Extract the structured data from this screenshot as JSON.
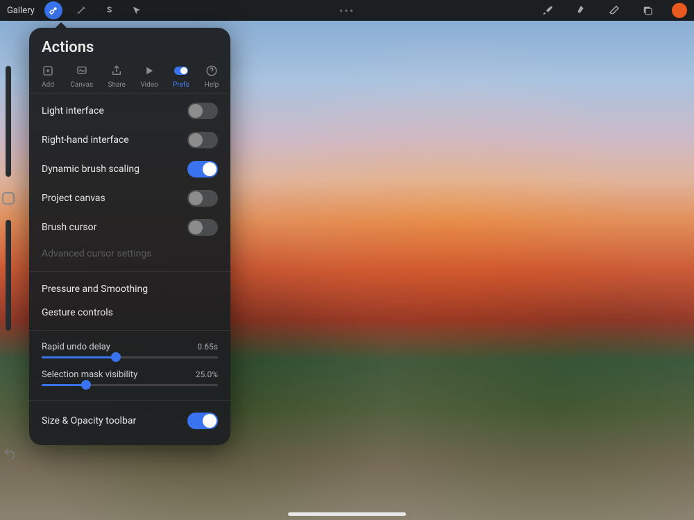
{
  "topbar": {
    "gallery_label": "Gallery",
    "ellipsis": "•••"
  },
  "actions": {
    "title": "Actions",
    "tabs": [
      {
        "label": "Add"
      },
      {
        "label": "Canvas"
      },
      {
        "label": "Share"
      },
      {
        "label": "Video"
      },
      {
        "label": "Prefs"
      },
      {
        "label": "Help"
      }
    ],
    "toggles": {
      "light_interface": {
        "label": "Light interface",
        "on": false
      },
      "right_hand": {
        "label": "Right-hand interface",
        "on": false
      },
      "dynamic_brush": {
        "label": "Dynamic brush scaling",
        "on": true
      },
      "project_canvas": {
        "label": "Project canvas",
        "on": false
      },
      "brush_cursor": {
        "label": "Brush cursor",
        "on": false
      },
      "size_opacity_toolbar": {
        "label": "Size & Opacity toolbar",
        "on": true
      }
    },
    "advanced_cursor": "Advanced cursor settings",
    "links": {
      "pressure": "Pressure and Smoothing",
      "gesture": "Gesture controls"
    },
    "sliders": {
      "rapid_undo": {
        "label": "Rapid undo delay",
        "value_text": "0.65s",
        "pct": 42
      },
      "mask_vis": {
        "label": "Selection mask visibility",
        "value_text": "25.0%",
        "pct": 25
      }
    }
  }
}
